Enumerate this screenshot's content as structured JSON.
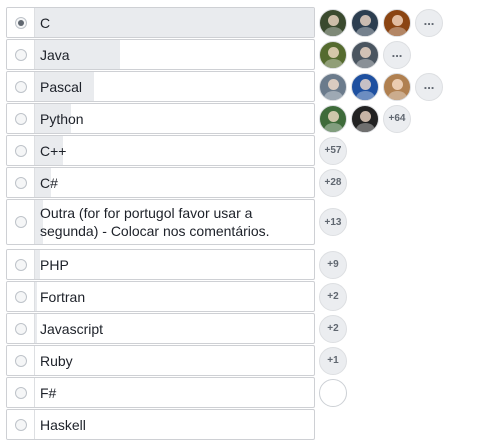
{
  "poll": {
    "options": [
      {
        "label": "C",
        "selected": true,
        "vote_share": 1.0,
        "avatars": [
          "#3a4a2e",
          "#2c3e50",
          "#8b4513"
        ],
        "more": "...",
        "count": ""
      },
      {
        "label": "Java",
        "selected": false,
        "vote_share": 0.3,
        "avatars": [
          "#556b2f",
          "#4a5560"
        ],
        "more": "...",
        "count": ""
      },
      {
        "label": "Pascal",
        "selected": false,
        "vote_share": 0.21,
        "avatars": [
          "#6b7b8c",
          "#1e50a0",
          "#b08050"
        ],
        "more": "...",
        "count": ""
      },
      {
        "label": "Python",
        "selected": false,
        "vote_share": 0.13,
        "avatars": [
          "#3e6b3a",
          "#222222"
        ],
        "more": "",
        "count": "+64"
      },
      {
        "label": "C++",
        "selected": false,
        "vote_share": 0.1,
        "avatars": [],
        "more": "",
        "count": "+57"
      },
      {
        "label": "C#",
        "selected": false,
        "vote_share": 0.06,
        "avatars": [],
        "more": "",
        "count": "+28"
      },
      {
        "label": "Outra (for for portugol favor usar a segunda) - Colocar nos comentários.",
        "selected": false,
        "vote_share": 0.03,
        "avatars": [],
        "more": "",
        "count": "+13"
      },
      {
        "label": "PHP",
        "selected": false,
        "vote_share": 0.02,
        "avatars": [],
        "more": "",
        "count": "+9"
      },
      {
        "label": "Fortran",
        "selected": false,
        "vote_share": 0.01,
        "avatars": [],
        "more": "",
        "count": "+2"
      },
      {
        "label": "Javascript",
        "selected": false,
        "vote_share": 0.01,
        "avatars": [],
        "more": "",
        "count": "+2"
      },
      {
        "label": "Ruby",
        "selected": false,
        "vote_share": 0.005,
        "avatars": [],
        "more": "",
        "count": "+1"
      },
      {
        "label": "F#",
        "selected": false,
        "vote_share": 0.003,
        "avatars": [],
        "more": "",
        "count": "",
        "empty_circle": true
      },
      {
        "label": "Haskell",
        "selected": false,
        "vote_share": 0,
        "avatars": [],
        "more": "",
        "count": ""
      }
    ]
  }
}
